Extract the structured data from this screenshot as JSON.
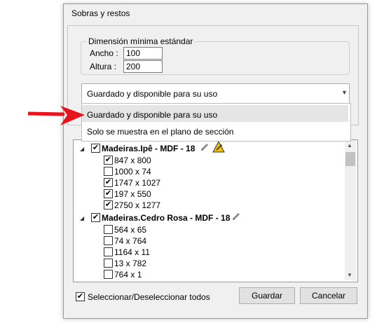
{
  "dialog": {
    "title": "Sobras y restos"
  },
  "group": {
    "legend": "Dimensión mínima estándar",
    "width_label": "Ancho :",
    "width_value": "100",
    "height_label": "Altura :",
    "height_value": "200"
  },
  "combo": {
    "selected": "Guardado y disponible para su uso",
    "options": [
      "Guardado y disponible para su uso",
      "Solo se muestra en el plano de sección"
    ]
  },
  "tree": {
    "groups": [
      {
        "label": "Madeiras.Ipê - MDF - 18",
        "checked": true,
        "items": [
          {
            "label": "847 x 800",
            "checked": true
          },
          {
            "label": "1000 x 74",
            "checked": false
          },
          {
            "label": "1747 x 1027",
            "checked": true
          },
          {
            "label": "197 x 550",
            "checked": true
          },
          {
            "label": "2750 x 1277",
            "checked": true
          }
        ]
      },
      {
        "label": "Madeiras.Cedro Rosa - MDF - 18",
        "checked": true,
        "items": [
          {
            "label": "564 x 65",
            "checked": false
          },
          {
            "label": "74 x 764",
            "checked": false
          },
          {
            "label": "1164 x 11",
            "checked": false
          },
          {
            "label": "13 x 782",
            "checked": false
          },
          {
            "label": "764 x 1",
            "checked": false
          }
        ]
      }
    ]
  },
  "footer": {
    "select_all_label": "Seleccionar/Deseleccionar todos",
    "select_all_checked": true,
    "save_label": "Guardar",
    "cancel_label": "Cancelar"
  },
  "icons": {
    "edit": "pencil-icon",
    "warning": "warning-icon",
    "annotation": "red-arrow"
  },
  "colors": {
    "annotation_arrow": "#e8141b",
    "highlight": "#e5e5e5"
  }
}
